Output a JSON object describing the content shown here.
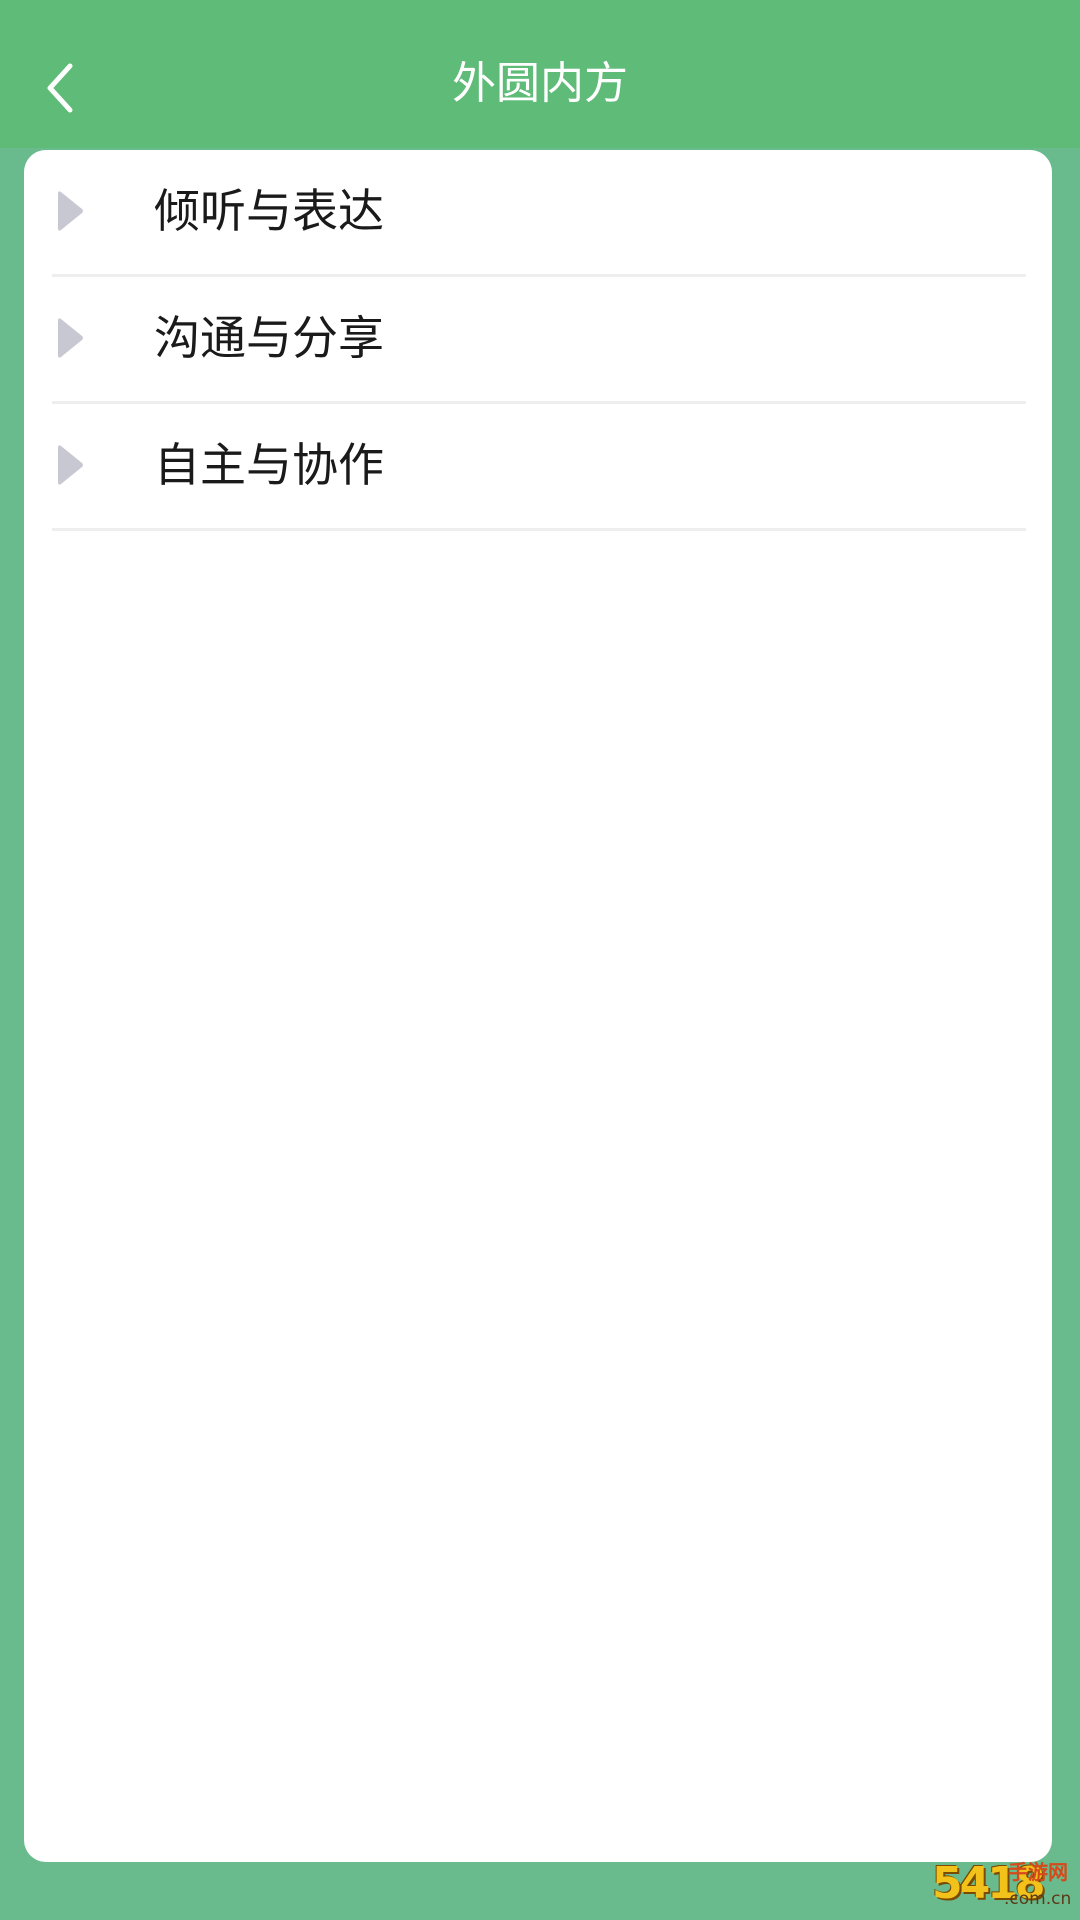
{
  "header": {
    "title": "外圆内方",
    "back_icon": "chevron-left-icon"
  },
  "list": {
    "item_icon": "caret-right-icon",
    "items": [
      {
        "label": "倾听与表达"
      },
      {
        "label": "沟通与分享"
      },
      {
        "label": "自主与协作"
      }
    ]
  },
  "watermark": {
    "number": "5418",
    "text": "手游网",
    "domain": ".com.cn"
  },
  "colors": {
    "header_bg": "#5fbb78",
    "page_bg": "#69ba8c",
    "card_bg": "#ffffff",
    "icon": "#c8c8d2"
  }
}
